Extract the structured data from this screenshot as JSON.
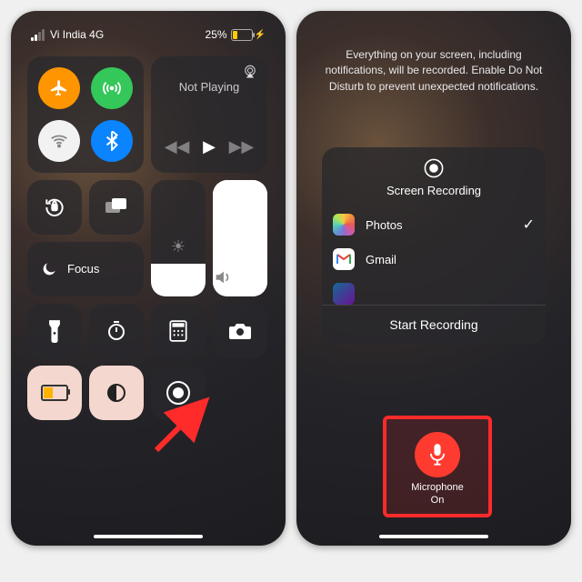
{
  "left": {
    "status": {
      "carrier": "Vi India 4G",
      "battery_pct": "25%"
    },
    "media": {
      "title": "Not Playing"
    },
    "focus": {
      "label": "Focus"
    }
  },
  "right": {
    "info": "Everything on your screen, including notifications, will be recorded. Enable Do Not Disturb to prevent unexpected notifications.",
    "sheet": {
      "title": "Screen Recording",
      "items": [
        "Photos",
        "Gmail"
      ],
      "start": "Start Recording"
    },
    "mic": {
      "label": "Microphone",
      "state": "On"
    }
  }
}
